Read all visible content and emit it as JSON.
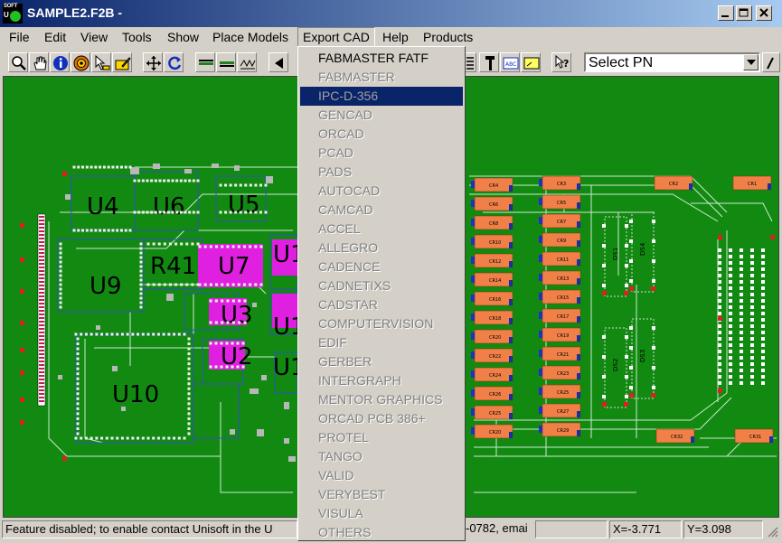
{
  "window": {
    "title": "SAMPLE2.F2B -"
  },
  "app_logo": {
    "line1": "SOFT",
    "line2": "U"
  },
  "menubar": {
    "items": [
      "File",
      "Edit",
      "View",
      "Tools",
      "Show",
      "Place Models",
      "Export CAD",
      "Help",
      "Products"
    ]
  },
  "toolbar": {
    "select_pn": {
      "value": "Select PN"
    }
  },
  "export_menu": {
    "items": [
      {
        "label": "FABMASTER FATF",
        "state": "enabled"
      },
      {
        "label": "FABMASTER",
        "state": "disabled"
      },
      {
        "label": "IPC-D-356",
        "state": "selected"
      },
      {
        "label": "GENCAD",
        "state": "disabled"
      },
      {
        "label": "ORCAD",
        "state": "disabled"
      },
      {
        "label": "PCAD",
        "state": "disabled"
      },
      {
        "label": "PADS",
        "state": "disabled"
      },
      {
        "label": "AUTOCAD",
        "state": "disabled"
      },
      {
        "label": "CAMCAD",
        "state": "disabled"
      },
      {
        "label": "ACCEL",
        "state": "disabled"
      },
      {
        "label": "ALLEGRO",
        "state": "disabled"
      },
      {
        "label": "CADENCE",
        "state": "disabled"
      },
      {
        "label": "CADNETIXS",
        "state": "disabled"
      },
      {
        "label": "CADSTAR",
        "state": "disabled"
      },
      {
        "label": "COMPUTERVISION",
        "state": "disabled"
      },
      {
        "label": "EDIF",
        "state": "disabled"
      },
      {
        "label": "GERBER",
        "state": "disabled"
      },
      {
        "label": "INTERGRAPH",
        "state": "disabled"
      },
      {
        "label": "MENTOR GRAPHICS",
        "state": "disabled"
      },
      {
        "label": "ORCAD PCB 386+",
        "state": "disabled"
      },
      {
        "label": "PROTEL",
        "state": "disabled"
      },
      {
        "label": "TANGO",
        "state": "disabled"
      },
      {
        "label": "VALID",
        "state": "disabled"
      },
      {
        "label": "VERYBEST",
        "state": "disabled"
      },
      {
        "label": "VISULA",
        "state": "disabled"
      },
      {
        "label": "OTHERS",
        "state": "disabled"
      }
    ]
  },
  "board": {
    "labels": [
      "U4",
      "U6",
      "U5",
      "U9",
      "R41",
      "U7",
      "U1",
      "U3",
      "U2",
      "U10",
      "U1",
      "U1"
    ],
    "resistors_left": [
      "CR4",
      "CR6",
      "CR8",
      "CR10",
      "CR12",
      "CR14",
      "CR16",
      "CR18",
      "CR20",
      "CR22",
      "CR24",
      "CR26",
      "CR25",
      "CR20"
    ],
    "resistors_mid": [
      "CR3",
      "CR5",
      "CR7",
      "CR9",
      "CR11",
      "CR13",
      "CR15",
      "CR17",
      "CR19",
      "CR21",
      "CR23",
      "CR25",
      "CR27",
      "CR29"
    ],
    "resistors_far": [
      "CR2",
      "CR1",
      "CR32",
      "CR31"
    ],
    "diodes": [
      "DS1",
      "DS4",
      "DS2",
      "DS3"
    ]
  },
  "statusbar": {
    "message": "Feature disabled; to enable contact Unisoft in the U",
    "message_tail": "-0782, emai",
    "x": "X=-3.771",
    "y": "Y=3.098"
  },
  "colors": {
    "board": "#128a12",
    "part_magenta": "#e020e0",
    "resistor": "#f08048",
    "menu_highlight": "#0a246a"
  }
}
